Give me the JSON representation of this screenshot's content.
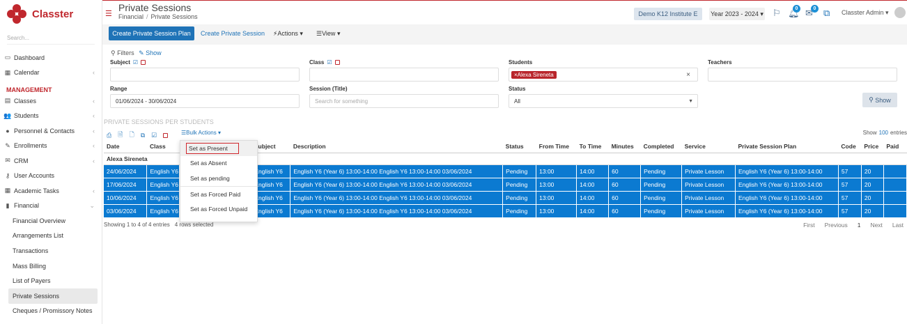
{
  "app": {
    "name": "Classter",
    "search_placeholder": "Search..."
  },
  "sidebar": {
    "top_items": [
      {
        "label": "Dashboard",
        "icon": "monitor-icon"
      },
      {
        "label": "Calendar",
        "icon": "calendar-icon"
      }
    ],
    "section_header": "MANAGEMENT",
    "items": [
      {
        "label": "Classes",
        "icon": "classes-icon"
      },
      {
        "label": "Students",
        "icon": "students-icon"
      },
      {
        "label": "Personnel & Contacts",
        "icon": "personnel-icon"
      },
      {
        "label": "Enrollments",
        "icon": "enrollments-icon"
      },
      {
        "label": "CRM",
        "icon": "crm-icon"
      },
      {
        "label": "User Accounts",
        "icon": "key-icon"
      },
      {
        "label": "Academic Tasks",
        "icon": "grid-icon"
      },
      {
        "label": "Financial",
        "icon": "financial-icon"
      }
    ],
    "financial_sub": [
      "Financial Overview",
      "Arrangements List",
      "Transactions",
      "Mass Billing",
      "List of Payers",
      "Private Sessions",
      "Cheques / Promissory Notes"
    ],
    "active_sub": "Private Sessions"
  },
  "header": {
    "title": "Private Sessions",
    "breadcrumb": [
      "Financial",
      "Private Sessions"
    ],
    "institute": "Demo K12 Institute E",
    "year": "Year 2023 - 2024",
    "notif_count": "0",
    "mail_count": "0",
    "user": "Classter Admin"
  },
  "toolbar": {
    "create_plan": "Create Private Session Plan",
    "create_session": "Create Private Session",
    "actions": "Actions",
    "view": "View"
  },
  "filters": {
    "title": "Filters",
    "show_link": "Show",
    "subject_label": "Subject",
    "class_label": "Class",
    "students_label": "Students",
    "student_tag": "Alexa Sireneta",
    "teachers_label": "Teachers",
    "range_label": "Range",
    "range_value": "01/06/2024 - 30/06/2024",
    "session_label": "Session (Title)",
    "session_placeholder": "Search for something",
    "status_label": "Status",
    "status_value": "All",
    "show_button": "Show"
  },
  "table": {
    "section_title": "PRIVATE SESSIONS PER STUDENTS",
    "bulk_actions": "Bulk Actions",
    "show_label": "Show",
    "show_count": "100",
    "entries_label": "entries",
    "columns": [
      "Date",
      "Class",
      "",
      "Subject",
      "Description",
      "Status",
      "From Time",
      "To Time",
      "Minutes",
      "Completed",
      "Service",
      "Private Session Plan",
      "Code",
      "Price",
      "Paid"
    ],
    "group": "Alexa Sireneta",
    "rows": [
      {
        "date": "24/06/2024",
        "class": "English Y6",
        "subject": "English Y6",
        "description": "English Y6 (Year 6) 13:00-14:00 English Y6 13:00-14:00 03/06/2024",
        "status": "Pending",
        "from": "13:00",
        "to": "14:00",
        "minutes": "60",
        "completed": "Pending",
        "service": "Private Lesson",
        "plan": "English Y6 (Year 6) 13:00-14:00",
        "code": "57",
        "price": "20",
        "paid": ""
      },
      {
        "date": "17/06/2024",
        "class": "English Y6",
        "subject": "English Y6",
        "description": "English Y6 (Year 6) 13:00-14:00 English Y6 13:00-14:00 03/06/2024",
        "status": "Pending",
        "from": "13:00",
        "to": "14:00",
        "minutes": "60",
        "completed": "Pending",
        "service": "Private Lesson",
        "plan": "English Y6 (Year 6) 13:00-14:00",
        "code": "57",
        "price": "20",
        "paid": ""
      },
      {
        "date": "10/06/2024",
        "class": "English Y6",
        "subject": "English Y6",
        "description": "English Y6 (Year 6) 13:00-14:00 English Y6 13:00-14:00 03/06/2024",
        "status": "Pending",
        "from": "13:00",
        "to": "14:00",
        "minutes": "60",
        "completed": "Pending",
        "service": "Private Lesson",
        "plan": "English Y6 (Year 6) 13:00-14:00",
        "code": "57",
        "price": "20",
        "paid": ""
      },
      {
        "date": "03/06/2024",
        "class": "English Y6",
        "subject": "English Y6",
        "description": "English Y6 (Year 6) 13:00-14:00 English Y6 13:00-14:00 03/06/2024",
        "status": "Pending",
        "from": "13:00",
        "to": "14:00",
        "minutes": "60",
        "completed": "Pending",
        "service": "Private Lesson",
        "plan": "English Y6 (Year 6) 13:00-14:00",
        "code": "57",
        "price": "20",
        "paid": ""
      }
    ],
    "footer_info": "Showing 1 to 4 of 4 entries",
    "rows_selected": "4 rows selected",
    "pager": {
      "first": "First",
      "previous": "Previous",
      "page": "1",
      "next": "Next",
      "last": "Last"
    }
  },
  "bulk_menu": {
    "items": [
      "Set as Present",
      "Set as Absent",
      "Set as pending",
      "Set as Forced Paid",
      "Set as Forced Unpaid"
    ]
  },
  "colors": {
    "brand": "#c0272d",
    "primary": "#1f73b7",
    "selected_row": "#0b7ad1"
  }
}
